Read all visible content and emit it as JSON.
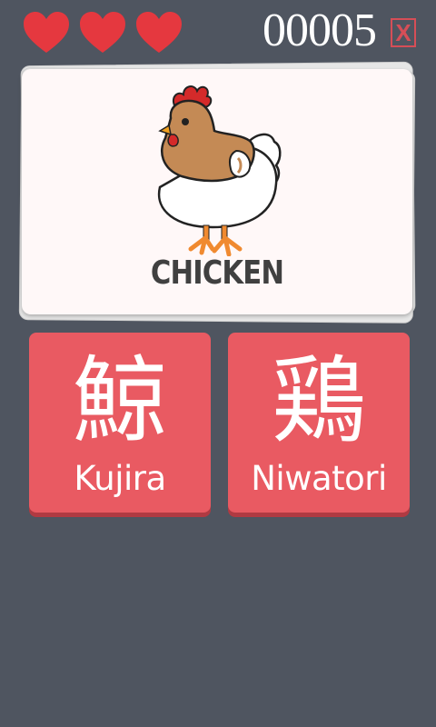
{
  "hud": {
    "lives": 3,
    "lives_max": 3,
    "score": "00005",
    "close_label": "X",
    "heart_color": "#e5383f"
  },
  "card": {
    "word": "CHICKEN",
    "picture": "chicken"
  },
  "answers": [
    {
      "kanji": "鯨",
      "romaji": "Kujira"
    },
    {
      "kanji": "鶏",
      "romaji": "Niwatori"
    }
  ],
  "colors": {
    "background": "#4f5560",
    "answer_button": "#e95a62",
    "card": "#fff8f8"
  }
}
